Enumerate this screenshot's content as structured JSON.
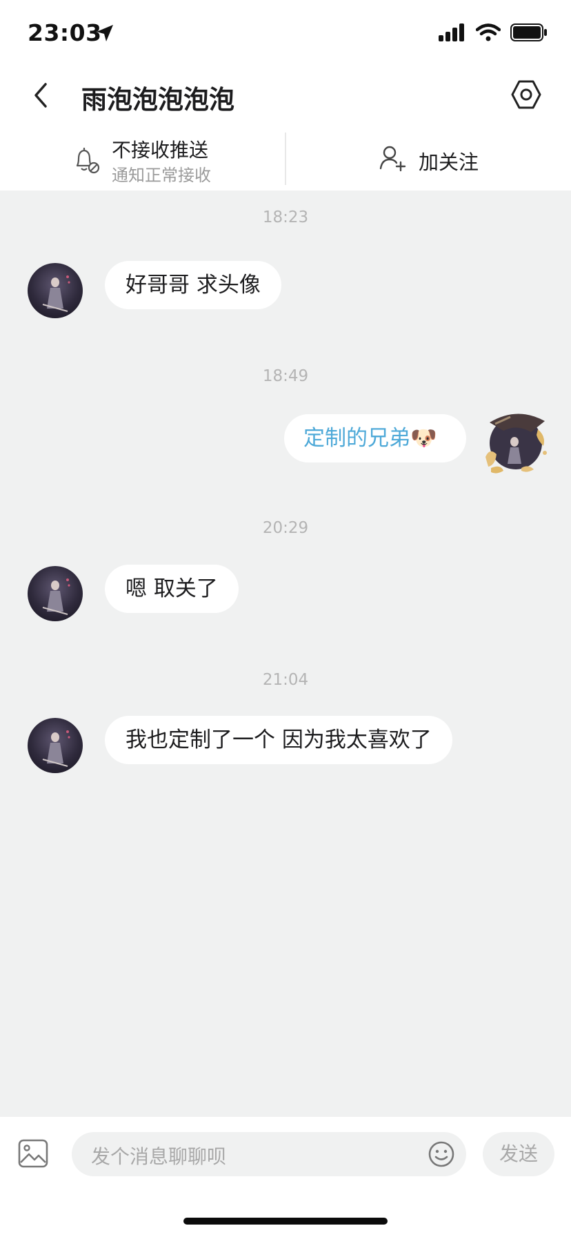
{
  "status_bar": {
    "time": "23:03"
  },
  "header": {
    "title": "雨泡泡泡泡泡"
  },
  "subbar": {
    "push_title": "不接收推送",
    "push_subtitle": "通知正常接收",
    "follow_label": "加关注"
  },
  "messages": [
    {
      "time": "18:23",
      "from": "other",
      "text": "好哥哥 求头像"
    },
    {
      "time": "18:49",
      "from": "me",
      "text": "定制的兄弟",
      "emoji": "🐶"
    },
    {
      "time": "20:29",
      "from": "other",
      "text": "嗯 取关了"
    },
    {
      "time": "21:04",
      "from": "other",
      "text": "我也定制了一个 因为我太喜欢了"
    }
  ],
  "composer": {
    "placeholder": "发个消息聊聊呗",
    "send_label": "发送"
  },
  "colors": {
    "chat_background": "#f0f1f1",
    "bubble_background": "#ffffff",
    "own_message_text": "#4ea9d8",
    "timestamp_text": "#b4b4b4"
  },
  "icons": [
    "navigation-arrow-icon",
    "signal-icon",
    "wifi-icon",
    "battery-icon",
    "back-chevron-icon",
    "settings-icon",
    "bell-muted-icon",
    "add-user-icon",
    "image-icon",
    "emoji-icon"
  ]
}
